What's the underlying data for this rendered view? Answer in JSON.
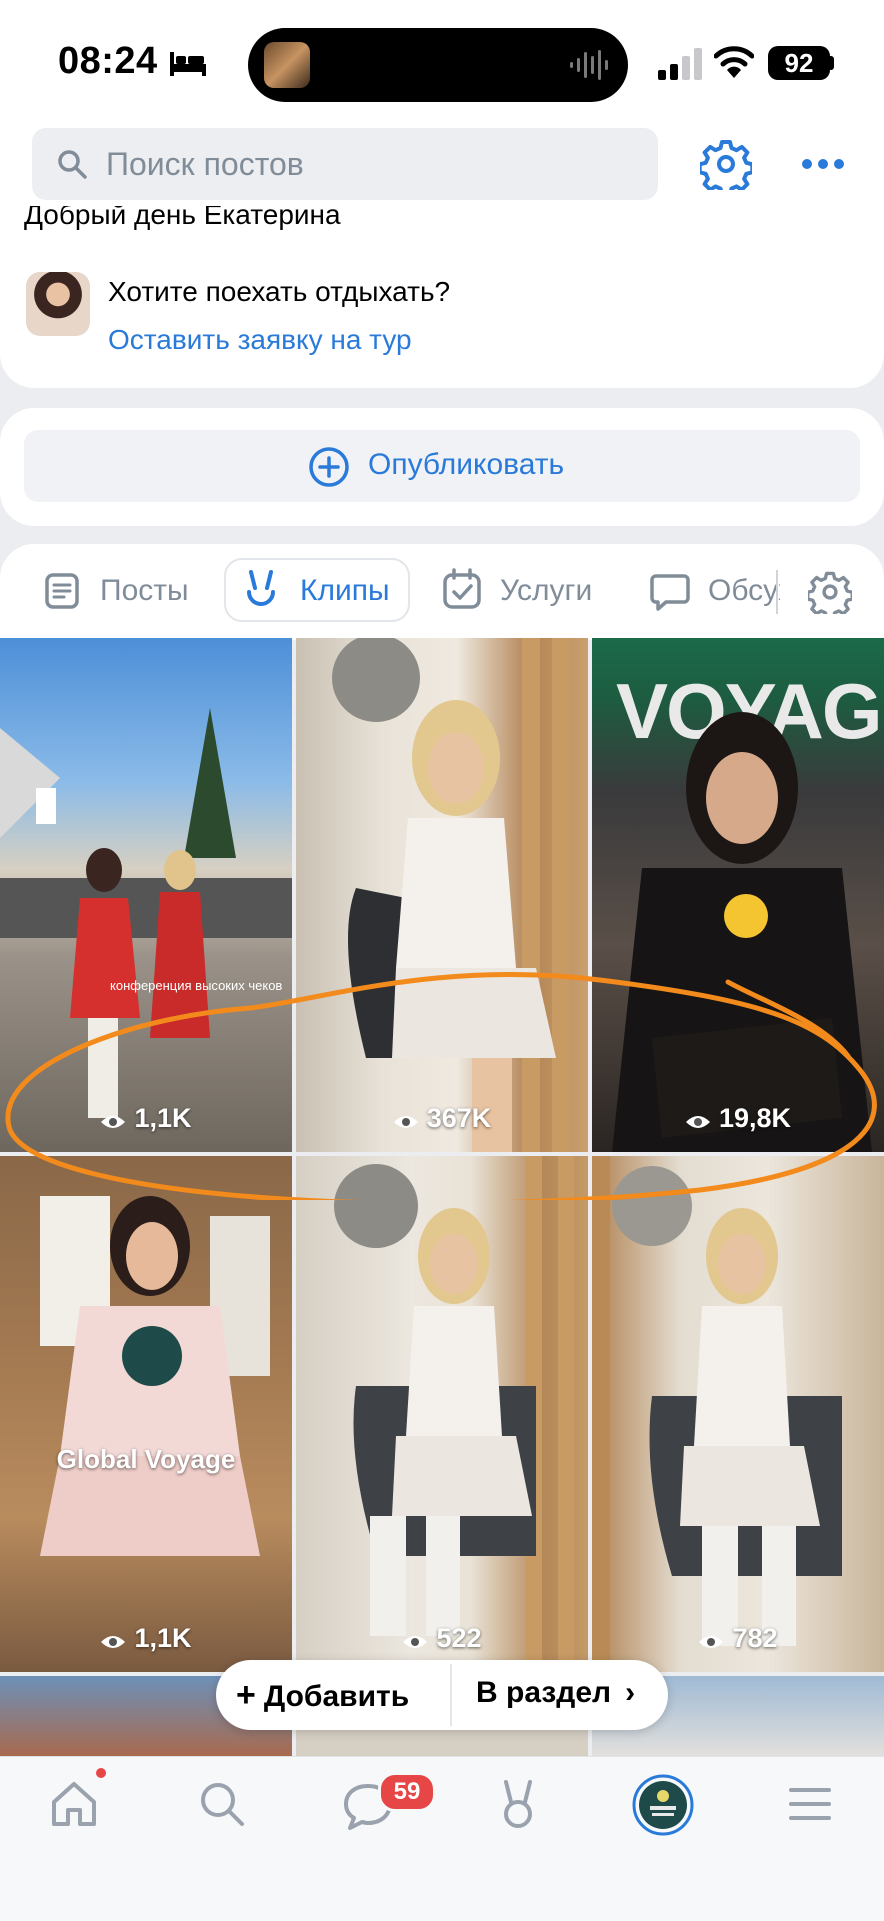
{
  "status_bar": {
    "time": "08:24",
    "battery": "92"
  },
  "header": {
    "search_placeholder": "Поиск постов"
  },
  "profile_card": {
    "greeting": "Добрый день Екатерина",
    "promo_title": "Хотите поехать отдыхать?",
    "promo_link": "Оставить заявку на тур"
  },
  "publish": {
    "label": "Опубликовать"
  },
  "tabs": [
    {
      "label": "Посты",
      "active": false
    },
    {
      "label": "Клипы",
      "active": true
    },
    {
      "label": "Услуги",
      "active": false
    },
    {
      "label": "Обсуждения",
      "active": false
    }
  ],
  "clips": [
    {
      "views": "1,1K",
      "overlay_text": "конференция высоких чеков"
    },
    {
      "views": "367K"
    },
    {
      "views": "19,8K",
      "overlay_text": "VOYAGE"
    },
    {
      "views": "1,1K",
      "overlay_text": "Global Voyage"
    },
    {
      "views": "522"
    },
    {
      "views": "782"
    }
  ],
  "floating_bar": {
    "add_label": "Добавить",
    "section_label": "В раздел"
  },
  "bottom_nav": {
    "items": [
      "home",
      "search",
      "messages",
      "clips",
      "profile",
      "menu"
    ],
    "messages_badge": "59"
  },
  "colors": {
    "accent": "#2a7ad9",
    "annotation": "#f28a1c",
    "badge": "#e64646"
  }
}
